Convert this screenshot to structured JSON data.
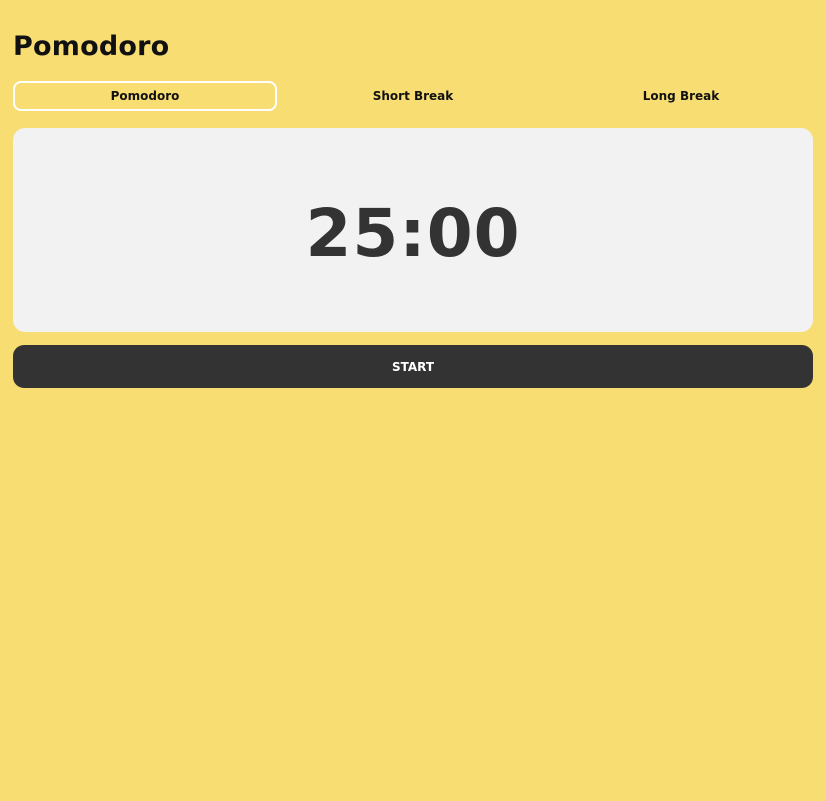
{
  "app": {
    "title": "Pomodoro"
  },
  "tabs": [
    {
      "label": "Pomodoro",
      "active": true
    },
    {
      "label": "Short Break",
      "active": false
    },
    {
      "label": "Long Break",
      "active": false
    }
  ],
  "timer": {
    "display": "25:00"
  },
  "controls": {
    "start_label": "START"
  },
  "colors": {
    "background": "#f8dd73",
    "card": "#f2f2f2",
    "button": "#333333",
    "active_tab_border": "#ffffff"
  }
}
